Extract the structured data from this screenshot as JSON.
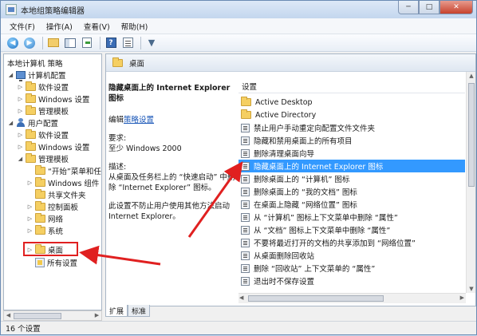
{
  "window": {
    "title": "本地组策略编辑器",
    "minimize": "─",
    "maximize": "□",
    "close": "✕"
  },
  "menu": [
    "文件(F)",
    "操作(A)",
    "查看(V)",
    "帮助(H)"
  ],
  "toolbar": {
    "back": "◀",
    "forward": "▶",
    "filter": "▼"
  },
  "tree": {
    "root": "本地计算机 策略",
    "computer_config": "计算机配置",
    "computer_children": [
      "软件设置",
      "Windows 设置",
      "管理模板"
    ],
    "user_config": "用户配置",
    "user_children": [
      "软件设置",
      "Windows 设置",
      "管理模板"
    ],
    "admin_children": [
      "“开始”菜单和任务栏",
      "Windows 组件",
      "共享文件夹",
      "控制面板",
      "网络",
      "系统",
      "桌面",
      "所有设置"
    ],
    "selected": "桌面"
  },
  "right": {
    "header": "桌面",
    "desc_title": "隐藏桌面上的 Internet Explorer 图标",
    "edit_prefix": "编辑",
    "edit_link": "策略设置",
    "req_label": "要求:",
    "req_value": "至少 Windows 2000",
    "desc_label": "描述:",
    "desc_text": "从桌面及任务栏上的 “快速启动” 中删除 “Internet Explorer” 图标。",
    "desc_text2": "此设置不防止用户使用其他方法启动 Internet Explorer。",
    "column": "设置",
    "settings": [
      {
        "label": "Active Desktop",
        "type": "folder"
      },
      {
        "label": "Active Directory",
        "type": "folder"
      },
      {
        "label": "禁止用户手动重定向配置文件文件夹",
        "type": "setting"
      },
      {
        "label": "隐藏和禁用桌面上的所有项目",
        "type": "setting"
      },
      {
        "label": "删除清理桌面向导",
        "type": "setting"
      },
      {
        "label": "隐藏桌面上的 Internet Explorer 图标",
        "type": "setting",
        "selected": true
      },
      {
        "label": "删除桌面上的 “计算机” 图标",
        "type": "setting"
      },
      {
        "label": "删除桌面上的 “我的文档” 图标",
        "type": "setting"
      },
      {
        "label": "在桌面上隐藏 “网络位置” 图标",
        "type": "setting"
      },
      {
        "label": "从 “计算机” 图标上下文菜单中删除 “属性”",
        "type": "setting"
      },
      {
        "label": "从 “文档” 图标上下文菜单中删除 “属性”",
        "type": "setting"
      },
      {
        "label": "不要将最近打开的文档的共享添加到 “网络位置”",
        "type": "setting"
      },
      {
        "label": "从桌面删除回收站",
        "type": "setting"
      },
      {
        "label": "删除 “回收站” 上下文菜单的 “属性”",
        "type": "setting"
      },
      {
        "label": "退出时不保存设置",
        "type": "setting"
      }
    ]
  },
  "tabs": [
    "扩展",
    "标准"
  ],
  "status": "16 个设置",
  "colors": {
    "selection": "#3399ff",
    "annotation": "#e02020"
  }
}
